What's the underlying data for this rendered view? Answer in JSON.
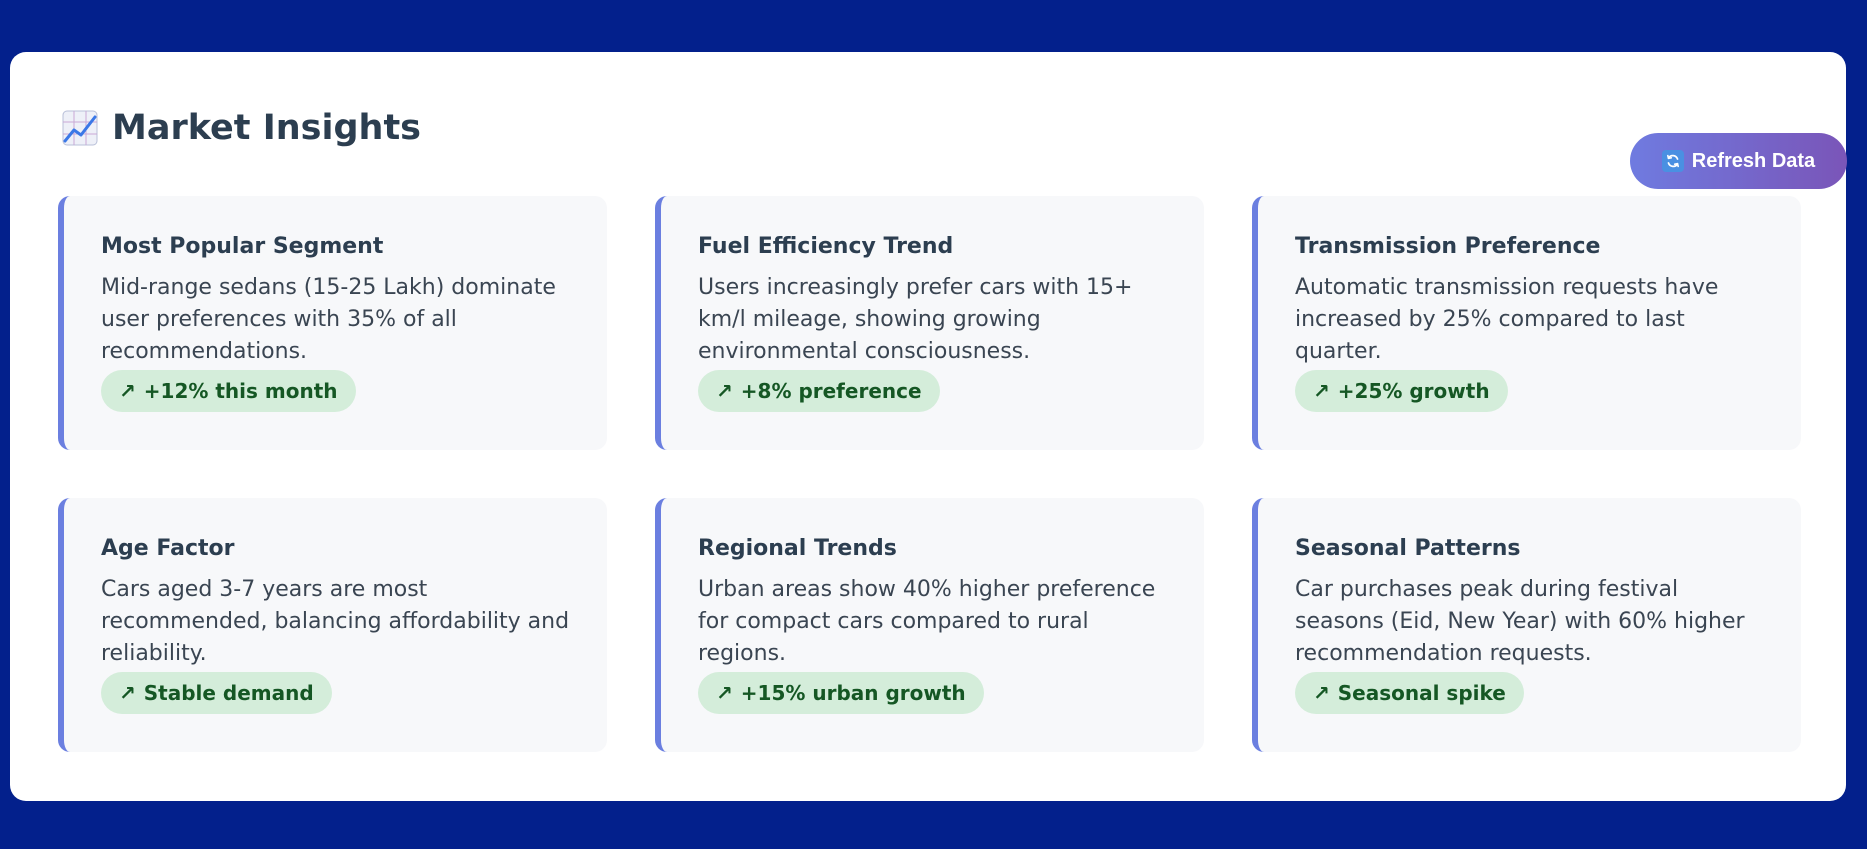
{
  "header": {
    "title": "Market Insights",
    "title_icon": "chart-increasing-icon",
    "refresh_label": "Refresh Data",
    "refresh_icon": "refresh-icon",
    "refresh_icon_glyph": "🔄"
  },
  "colors": {
    "background": "#03208c",
    "accent_border": "#6b7fe0",
    "badge_bg": "#d4edda",
    "badge_text": "#155724",
    "button_gradient_start": "#6f7be0",
    "button_gradient_end": "#7a55b8"
  },
  "badge_arrow": "↗",
  "cards": [
    {
      "title": "Most Popular Segment",
      "description": "Mid-range sedans (15-25 Lakh) dominate user preferences with 35% of all recommendations.",
      "badge": "+12% this month"
    },
    {
      "title": "Fuel Efficiency Trend",
      "description": "Users increasingly prefer cars with 15+ km/l mileage, showing growing environmental consciousness.",
      "badge": "+8% preference"
    },
    {
      "title": "Transmission Preference",
      "description": "Automatic transmission requests have increased by 25% compared to last quarter.",
      "badge": "+25% growth"
    },
    {
      "title": "Age Factor",
      "description": "Cars aged 3-7 years are most recommended, balancing affordability and reliability.",
      "badge": "Stable demand"
    },
    {
      "title": "Regional Trends",
      "description": "Urban areas show 40% higher preference for compact cars compared to rural regions.",
      "badge": "+15% urban growth"
    },
    {
      "title": "Seasonal Patterns",
      "description": "Car purchases peak during festival seasons (Eid, New Year) with 60% higher recommendation requests.",
      "badge": "Seasonal spike"
    }
  ]
}
